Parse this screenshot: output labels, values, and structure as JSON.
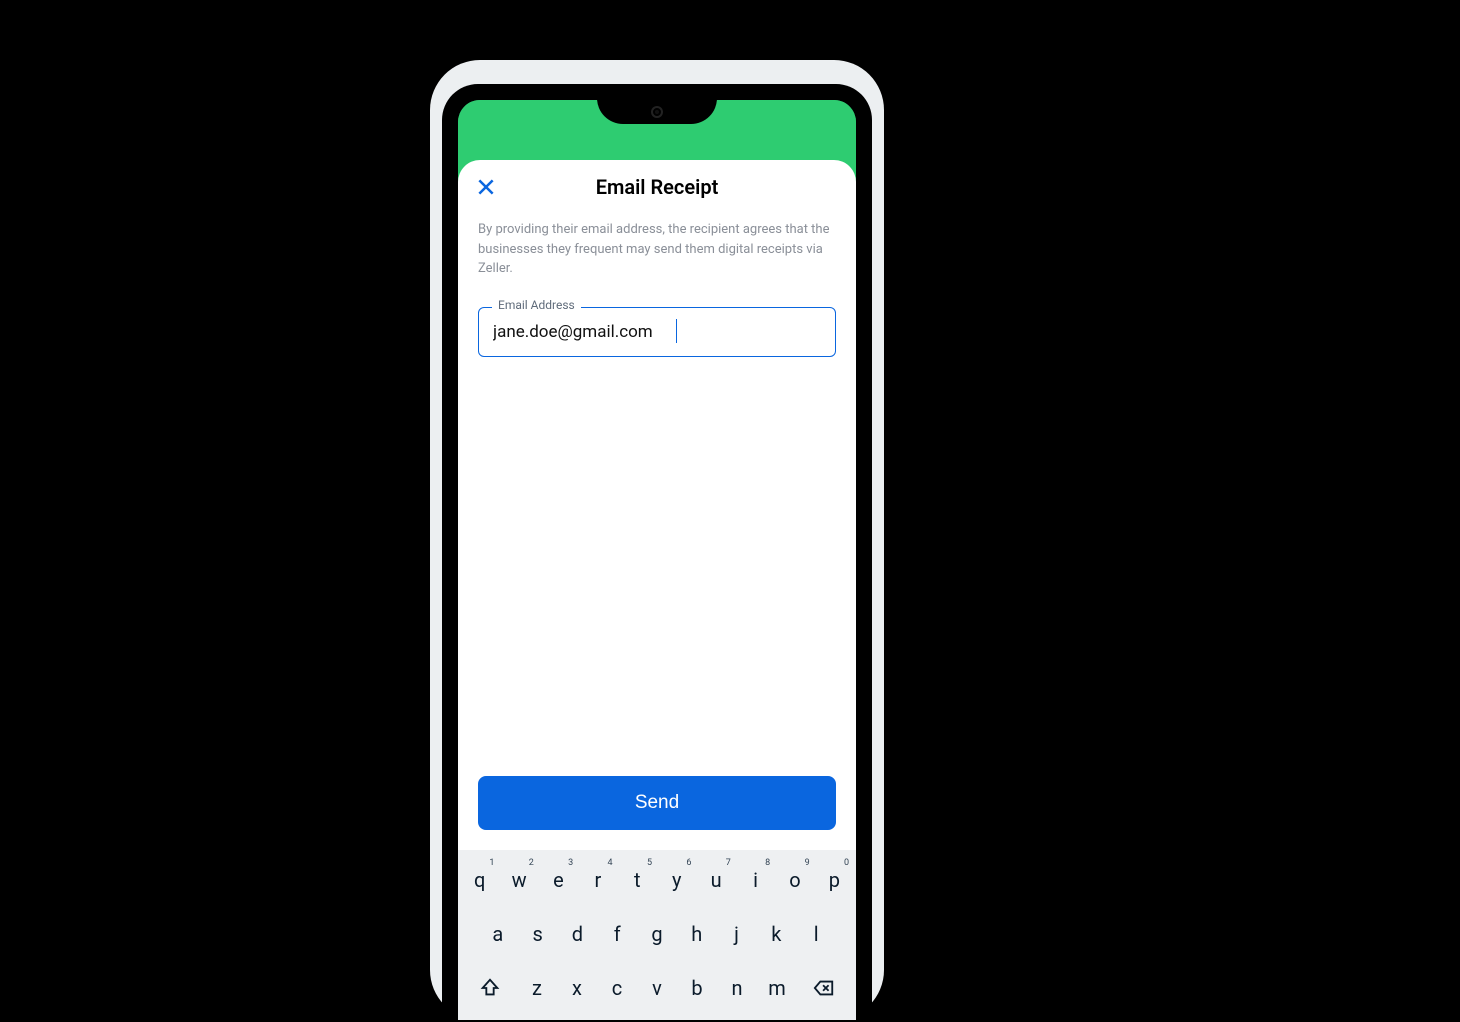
{
  "sheet": {
    "title": "Email Receipt",
    "disclaimer": "By providing their email address, the recipient agrees that the businesses they frequent may send them digital receipts via Zeller.",
    "email_label": "Email Address",
    "email_value": "jane.doe@gmail.com",
    "send_label": "Send"
  },
  "keyboard": {
    "row1": [
      {
        "k": "q",
        "n": "1"
      },
      {
        "k": "w",
        "n": "2"
      },
      {
        "k": "e",
        "n": "3"
      },
      {
        "k": "r",
        "n": "4"
      },
      {
        "k": "t",
        "n": "5"
      },
      {
        "k": "y",
        "n": "6"
      },
      {
        "k": "u",
        "n": "7"
      },
      {
        "k": "i",
        "n": "8"
      },
      {
        "k": "o",
        "n": "9"
      },
      {
        "k": "p",
        "n": "0"
      }
    ],
    "row2": [
      "a",
      "s",
      "d",
      "f",
      "g",
      "h",
      "j",
      "k",
      "l"
    ],
    "row3": [
      "z",
      "x",
      "c",
      "v",
      "b",
      "n",
      "m"
    ]
  }
}
